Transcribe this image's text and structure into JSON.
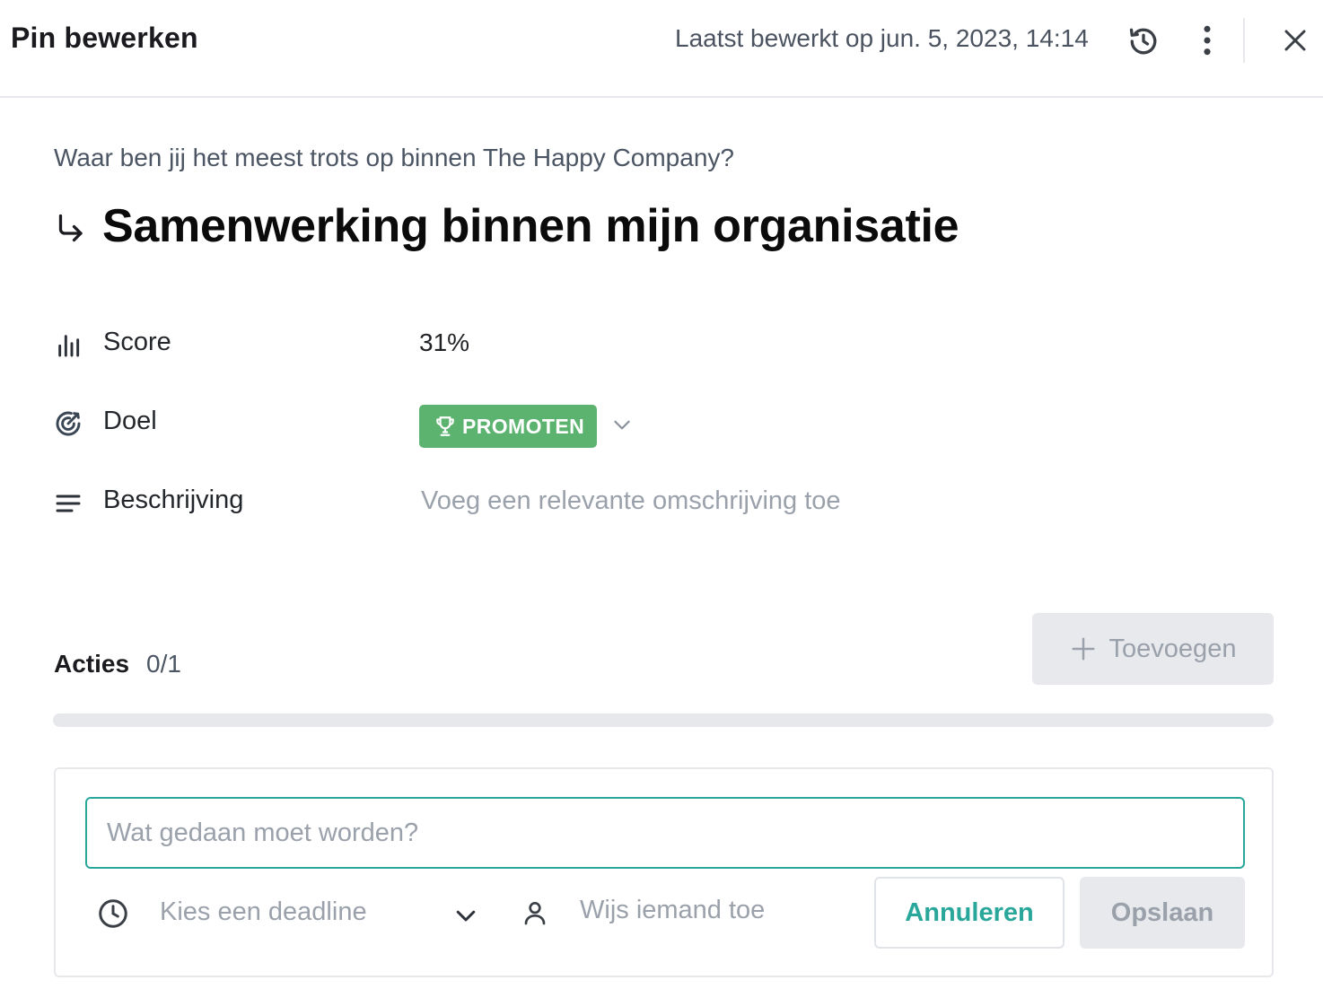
{
  "header": {
    "title": "Pin bewerken",
    "last_edited": "Laatst bewerkt op jun. 5, 2023, 14:14",
    "icons": [
      "history-icon",
      "more-vertical-icon",
      "close-icon"
    ]
  },
  "pin": {
    "question": "Waar ben jij het meest trots op binnen The Happy Company?",
    "answer": "Samenwerking binnen mijn organisatie"
  },
  "fields": {
    "score": {
      "label": "Score",
      "value": "31%",
      "icon": "bar-chart-icon"
    },
    "goal": {
      "label": "Doel",
      "value": "PROMOTEN",
      "icon": "target-icon",
      "badge_color": "#5cb36f"
    },
    "description": {
      "label": "Beschrijving",
      "placeholder": "Voeg een relevante omschrijving toe",
      "icon": "text-lines-icon"
    }
  },
  "actions": {
    "label": "Acties",
    "count": "0/1",
    "progress": 0,
    "add_label": "Toevoegen",
    "accent_color": "#2aa79b",
    "form": {
      "input_placeholder": "Wat gedaan moet worden?",
      "input_value": "",
      "deadline_placeholder": "Kies een deadline",
      "assignee_placeholder": "Wijs iemand toe",
      "cancel_label": "Annuleren",
      "save_label": "Opslaan"
    }
  }
}
